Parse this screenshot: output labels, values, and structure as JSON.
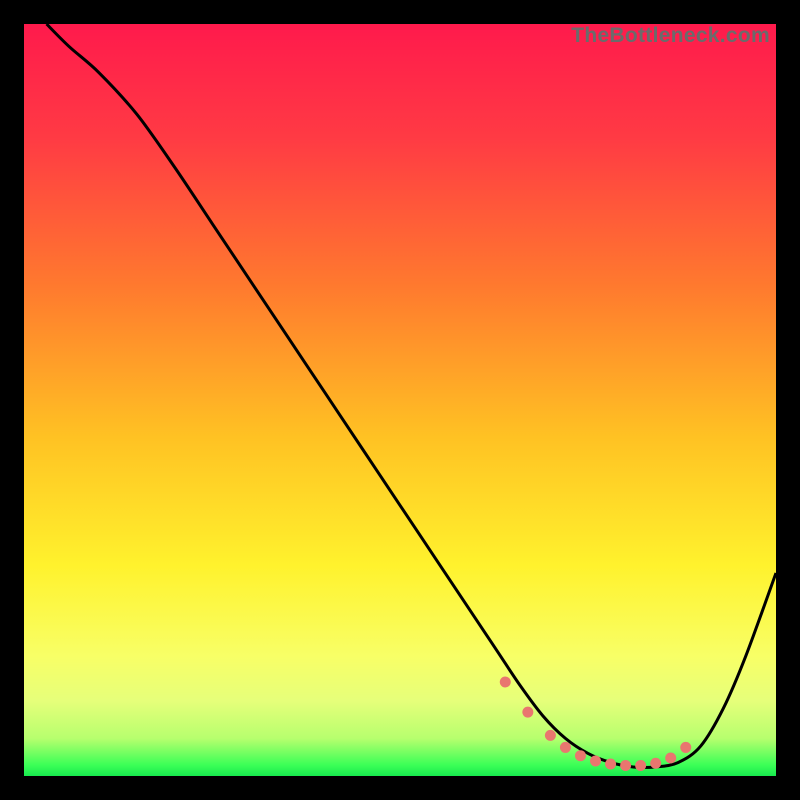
{
  "watermark": "TheBottleneck.com",
  "colors": {
    "background": "#000000",
    "curve": "#000000",
    "dots": "#e9766f",
    "gradient_stops": [
      {
        "offset": 0.0,
        "color": "#ff1a4c"
      },
      {
        "offset": 0.15,
        "color": "#ff3a44"
      },
      {
        "offset": 0.35,
        "color": "#ff7a2e"
      },
      {
        "offset": 0.55,
        "color": "#ffc223"
      },
      {
        "offset": 0.72,
        "color": "#fff22d"
      },
      {
        "offset": 0.84,
        "color": "#f8ff66"
      },
      {
        "offset": 0.9,
        "color": "#e6ff7a"
      },
      {
        "offset": 0.95,
        "color": "#b7ff6e"
      },
      {
        "offset": 0.985,
        "color": "#3dff57"
      },
      {
        "offset": 1.0,
        "color": "#17e94e"
      }
    ]
  },
  "chart_data": {
    "type": "line",
    "title": "",
    "xlabel": "",
    "ylabel": "",
    "xlim": [
      0,
      100
    ],
    "ylim": [
      0,
      100
    ],
    "series": [
      {
        "name": "curve",
        "x": [
          3,
          6,
          10,
          15,
          20,
          25,
          30,
          35,
          40,
          45,
          50,
          55,
          60,
          63,
          66,
          69,
          72,
          75,
          78,
          81,
          84,
          87,
          90,
          93,
          96,
          100
        ],
        "y": [
          100,
          97,
          93.5,
          88,
          81,
          73.5,
          66,
          58.5,
          51,
          43.5,
          36,
          28.5,
          21,
          16.5,
          12,
          8,
          5,
          3,
          1.8,
          1.2,
          1.2,
          1.8,
          4,
          9,
          16,
          27
        ]
      }
    ],
    "flat_region": {
      "x": [
        64,
        67,
        70,
        72,
        74,
        76,
        78,
        80,
        82,
        84,
        86,
        88
      ],
      "y": [
        12.5,
        8.5,
        5.4,
        3.8,
        2.7,
        2.0,
        1.6,
        1.4,
        1.4,
        1.7,
        2.4,
        3.8
      ]
    }
  }
}
